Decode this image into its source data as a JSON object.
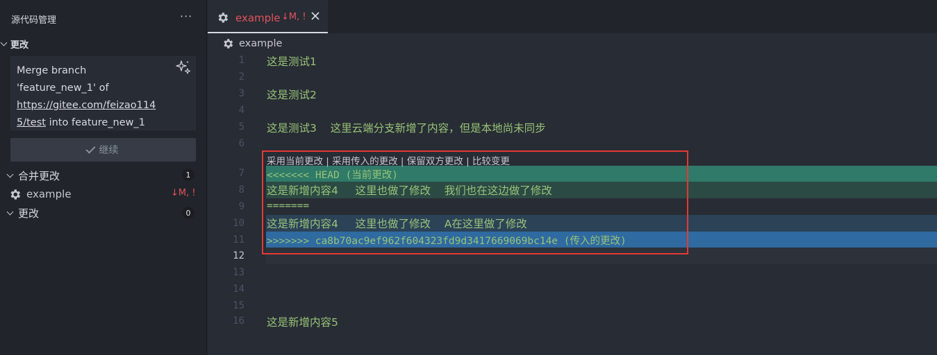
{
  "sidebar": {
    "title": "源代码管理",
    "more": "···",
    "changes_section": "更改",
    "commit_message": {
      "line1": "Merge branch",
      "line2": "'feature_new_1' of",
      "line3": "https://gitee.com/feizao114",
      "line4_link": "5/test",
      "line4_rest": " into feature_new_1"
    },
    "continue_label": "继续",
    "merge_section": "合并更改",
    "merge_count": "1",
    "merge_file": {
      "name": "example",
      "status": "↓M, !"
    },
    "changes_sub": "更改",
    "changes_count": "0"
  },
  "tab": {
    "label": "example",
    "status": "↓M, !"
  },
  "breadcrumb": {
    "label": "example"
  },
  "codelens": {
    "accept_current": "采用当前更改",
    "accept_incoming": "采用传入的更改",
    "accept_both": "保留双方更改",
    "compare": "比较变更",
    "sep": " | "
  },
  "lines": [
    {
      "num": "1",
      "text": "这是测试1"
    },
    {
      "num": "2",
      "text": ""
    },
    {
      "num": "3",
      "text": "这是测试2"
    },
    {
      "num": "4",
      "text": ""
    },
    {
      "num": "5",
      "text": "这是测试3    这里云端分支新增了内容，但是本地尚未同步"
    },
    {
      "num": "6",
      "text": ""
    },
    {
      "num": "7",
      "text": "<<<<<<< HEAD (当前更改)"
    },
    {
      "num": "8",
      "text": "这是新增内容4     这里也做了修改    我们也在这边做了修改"
    },
    {
      "num": "9",
      "text": "======="
    },
    {
      "num": "10",
      "text": "这是新增内容4     这里也做了修改    A在这里做了修改"
    },
    {
      "num": "11",
      "text": ">>>>>>> ca8b70ac9ef962f604323fd9d3417669069bc14e (传入的更改)"
    },
    {
      "num": "12",
      "text": ""
    },
    {
      "num": "13",
      "text": ""
    },
    {
      "num": "14",
      "text": ""
    },
    {
      "num": "15",
      "text": ""
    },
    {
      "num": "16",
      "text": "这是新增内容5"
    }
  ],
  "colors": {
    "current_header": "#2f7a68",
    "current_body": "#2c4a44",
    "incoming_body": "#2c4257",
    "incoming_header": "#2f6aa0",
    "modified": "#e2535d",
    "string": "#98c379",
    "highlight_box": "#e53935"
  }
}
